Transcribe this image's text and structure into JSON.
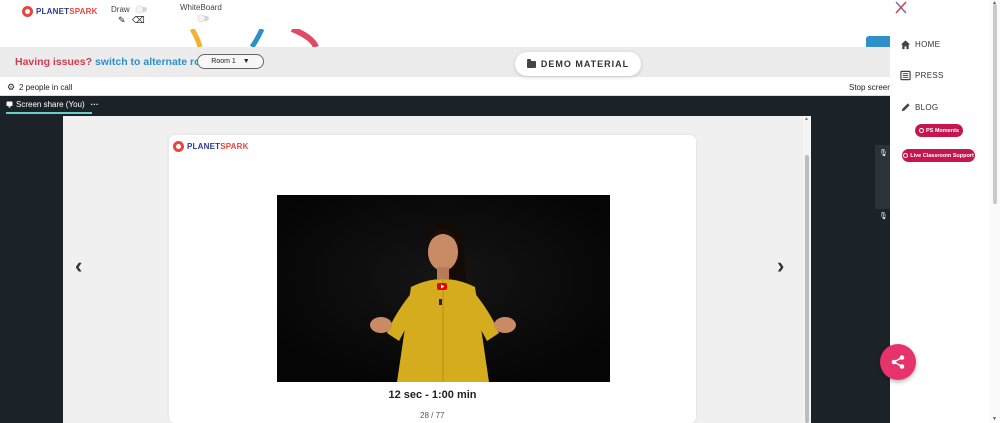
{
  "brand": {
    "name_part1": "PLANET",
    "name_part2": "SPARK"
  },
  "toolbar": {
    "draw_label": "Draw",
    "whiteboard_label": "WhiteBoard"
  },
  "issue_bar": {
    "issue_text": "Having issues?",
    "switch_link": "switch to alternate room",
    "room_selected": "Room 1",
    "room_caret": "▼"
  },
  "demo_material": {
    "label": "DEMO MATERIAL"
  },
  "call": {
    "people_text": "2 people in call",
    "stop_label": "Stop screen"
  },
  "share_tab": {
    "label": "Screen share (You)",
    "more": "···"
  },
  "slide": {
    "timer": "12 sec - 1:00 min",
    "page": "28 / 77"
  },
  "side_menu": {
    "items": [
      {
        "label": "HOME",
        "icon": "home-icon"
      },
      {
        "label": "PRESS",
        "icon": "newspaper-icon"
      },
      {
        "label": "BLOG",
        "icon": "pencil-icon"
      }
    ],
    "pills": [
      {
        "label": "PS Moments"
      },
      {
        "label": "Live Classroom Support"
      }
    ]
  },
  "colors": {
    "accent_red": "#d33a50",
    "link_blue": "#2f8fc8",
    "pill_magenta": "#c7164f",
    "fab_pink": "#e6336c",
    "dark_bg": "#1c2328"
  }
}
